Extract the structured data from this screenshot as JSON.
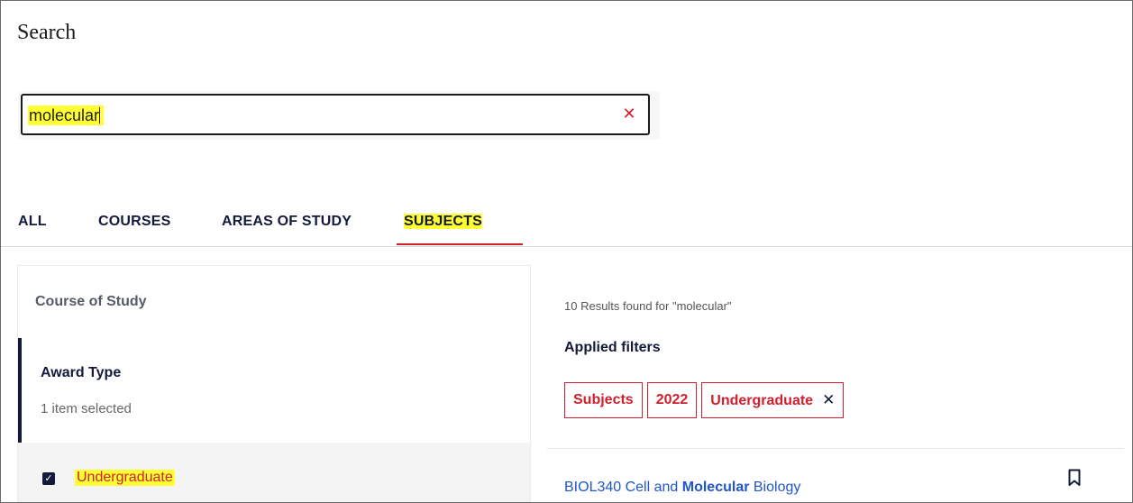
{
  "page": {
    "title": "Search"
  },
  "search": {
    "value": "molecular",
    "clear_icon": "close-icon",
    "clear_glyph": "✕"
  },
  "tabs": [
    {
      "label": "ALL",
      "active": false
    },
    {
      "label": "COURSES",
      "active": false
    },
    {
      "label": "AREAS OF STUDY",
      "active": false
    },
    {
      "label": "SUBJECTS",
      "active": true
    }
  ],
  "filters": {
    "heading": "Course of Study",
    "award_type": {
      "title": "Award Type",
      "subtitle": "1 item selected",
      "options": [
        {
          "label": "Undergraduate",
          "checked": true
        }
      ]
    }
  },
  "results": {
    "count_text": "10 Results found for \"molecular\"",
    "applied_title": "Applied filters",
    "applied_filters": [
      "Subjects",
      "2022",
      "Undergraduate"
    ],
    "remove_glyph": "✕",
    "items": [
      {
        "prefix": "BIOL340 Cell and ",
        "highlight": "Molecular",
        "suffix": " Biology",
        "icon": "bookmark-icon"
      }
    ]
  },
  "colors": {
    "accent_red": "#d0202e",
    "navy": "#131a3a",
    "link_blue": "#1f56c9",
    "highlight": "#ffff33"
  }
}
